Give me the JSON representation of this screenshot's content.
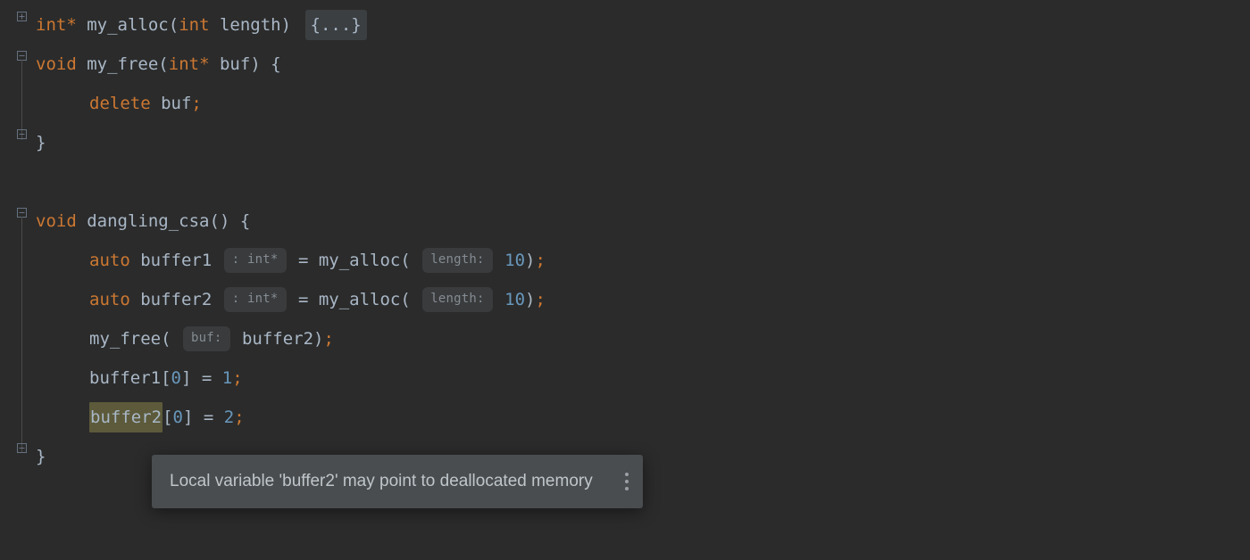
{
  "code": {
    "l1": {
      "kw_int": "int",
      "star": "*",
      "fn": "my_alloc",
      "paren_open": "(",
      "param_kw": "int",
      "param_name": "length",
      "paren_close": ")",
      "folded": "{...}"
    },
    "l2": {
      "kw_void": "void",
      "fn": "my_free",
      "paren_open": "(",
      "param_kw": "int",
      "star": "*",
      "param_name": "buf",
      "paren_close": ")",
      "brace": "{"
    },
    "l3": {
      "kw_delete": "delete",
      "id": "buf",
      "semi": ";"
    },
    "l4": {
      "brace": "}"
    },
    "l5": {
      "kw_void": "void",
      "fn": "dangling_csa",
      "parens": "()",
      "brace": "{"
    },
    "l6": {
      "kw_auto": "auto",
      "id": "buffer1",
      "hint_type": ": int*",
      "eq": " = ",
      "call": "my_alloc",
      "paren_open": "(",
      "hint_param": "length:",
      "num": "10",
      "paren_close": ")",
      "semi": ";"
    },
    "l7": {
      "kw_auto": "auto",
      "id": "buffer2",
      "hint_type": ": int*",
      "eq": " = ",
      "call": "my_alloc",
      "paren_open": "(",
      "hint_param": "length:",
      "num": "10",
      "paren_close": ")",
      "semi": ";"
    },
    "l8": {
      "call": "my_free",
      "paren_open": "(",
      "hint_param": "buf:",
      "arg": "buffer2",
      "paren_close": ")",
      "semi": ";"
    },
    "l9": {
      "id": "buffer1",
      "bracket_open": "[",
      "idx": "0",
      "bracket_close": "]",
      "eq": " = ",
      "num": "1",
      "semi": ";"
    },
    "l10": {
      "id_warn": "buffer2",
      "bracket_open": "[",
      "idx": "0",
      "bracket_close": "]",
      "eq": " = ",
      "num": "2",
      "semi": ";"
    },
    "l11": {
      "brace": "}"
    }
  },
  "tooltip": {
    "message": "Local variable 'buffer2' may point to deallocated memory"
  },
  "gutter": {
    "expand": "⊞",
    "collapse_top": "⊟",
    "collapse_bottom": "⊟"
  }
}
